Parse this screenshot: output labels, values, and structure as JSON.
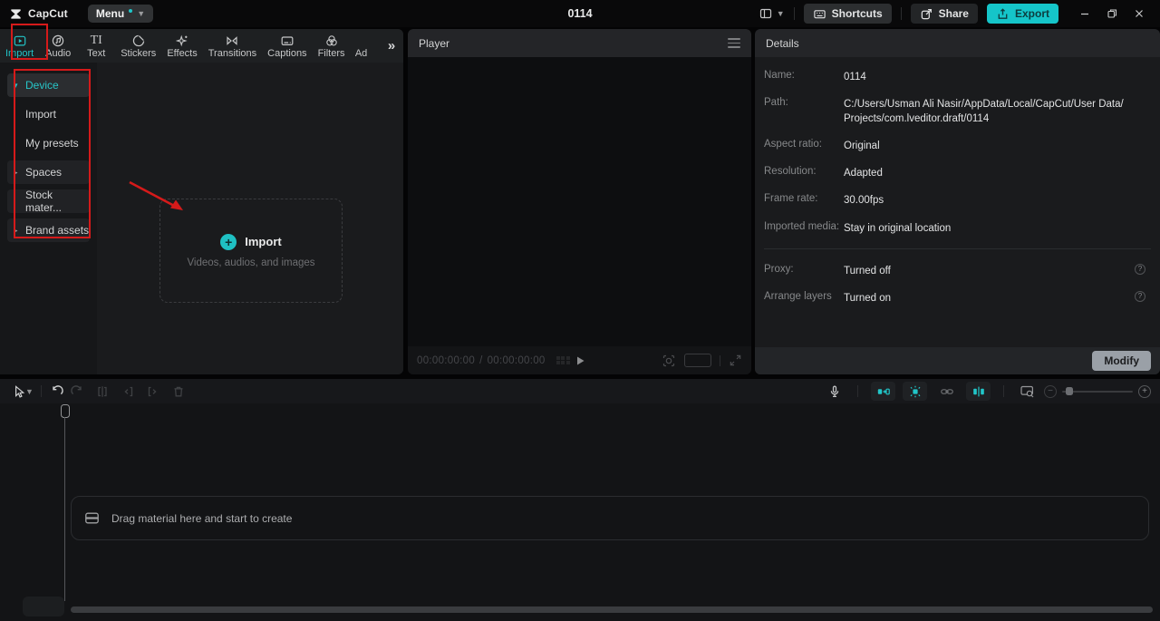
{
  "colors": {
    "accent": "#1fc6c9",
    "export_bg": "#15c5c9",
    "annotation": "#d51a1a"
  },
  "titlebar": {
    "app_name": "CapCut",
    "menu_label": "Menu",
    "project_title": "0114",
    "shortcuts_label": "Shortcuts",
    "share_label": "Share",
    "export_label": "Export"
  },
  "media_panel": {
    "tabs": [
      {
        "label": "Import"
      },
      {
        "label": "Audio"
      },
      {
        "label": "Text"
      },
      {
        "label": "Stickers"
      },
      {
        "label": "Effects"
      },
      {
        "label": "Transitions"
      },
      {
        "label": "Captions"
      },
      {
        "label": "Filters"
      },
      {
        "label": "Ad"
      }
    ],
    "sidebar": {
      "device": "Device",
      "import": "Import",
      "my_presets": "My presets",
      "spaces": "Spaces",
      "stock_materials": "Stock mater...",
      "brand_assets": "Brand assets"
    },
    "dropzone": {
      "title": "Import",
      "subtitle": "Videos, audios, and images"
    }
  },
  "player": {
    "title": "Player",
    "timecode_current": "00:00:00:00",
    "timecode_separator": "/",
    "timecode_total": "00:00:00:00"
  },
  "details": {
    "title": "Details",
    "rows": [
      {
        "label": "Name:",
        "value": "0114"
      },
      {
        "label": "Path:",
        "value": "C:/Users/Usman Ali Nasir/AppData/Local/CapCut/User Data/Projects/com.lveditor.draft/0114"
      },
      {
        "label": "Aspect ratio:",
        "value": "Original"
      },
      {
        "label": "Resolution:",
        "value": "Adapted"
      },
      {
        "label": "Frame rate:",
        "value": "30.00fps"
      },
      {
        "label": "Imported media:",
        "value": "Stay in original location"
      }
    ],
    "toggles": [
      {
        "label": "Proxy:",
        "value": "Turned off"
      },
      {
        "label": "Arrange layers",
        "value": "Turned on"
      }
    ],
    "modify_label": "Modify"
  },
  "timeline": {
    "empty_text": "Drag material here and start to create"
  }
}
